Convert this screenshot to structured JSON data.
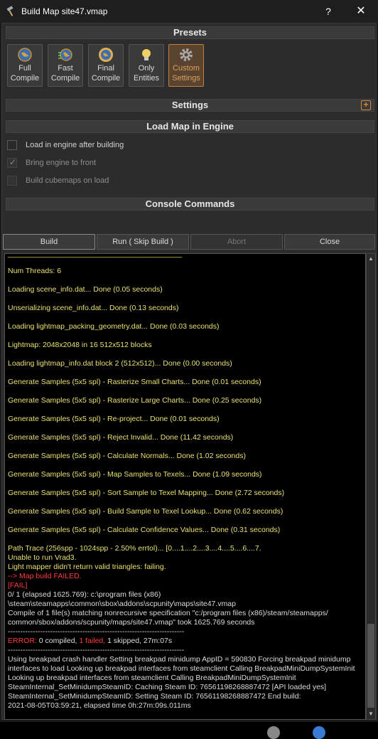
{
  "window": {
    "title": "Build Map site47.vmap",
    "help_glyph": "?",
    "close_glyph": "✕"
  },
  "presets": {
    "header": "Presets",
    "items": [
      {
        "line1": "Full",
        "line2": "Compile",
        "icon": "globe-icon"
      },
      {
        "line1": "Fast",
        "line2": "Compile",
        "icon": "globe-fast-icon"
      },
      {
        "line1": "Final",
        "line2": "Compile",
        "icon": "globe-final-icon"
      },
      {
        "line1": "Only",
        "line2": "Entities",
        "icon": "lightbulb-icon"
      },
      {
        "line1": "Custom",
        "line2": "Settings",
        "icon": "gear-icon"
      }
    ]
  },
  "settings": {
    "header": "Settings",
    "expand_glyph": "+"
  },
  "load_map": {
    "header": "Load Map in Engine",
    "options": [
      {
        "label": "Load in engine after building",
        "checked": false,
        "enabled": true
      },
      {
        "label": "Bring engine to front",
        "checked": true,
        "enabled": false
      },
      {
        "label": "Build cubemaps on load",
        "checked": false,
        "enabled": false
      }
    ]
  },
  "console_commands": {
    "header": "Console Commands"
  },
  "actions": {
    "build": "Build",
    "run": "Run ( Skip Build )",
    "abort": "Abort",
    "close": "Close"
  },
  "console": {
    "lines": [
      {
        "text": "Num Threads: 6",
        "color": "y"
      },
      {
        "text": "Loading scene_info.dat... Done (0.05 seconds)",
        "color": "y"
      },
      {
        "text": "Unserializing scene_info.dat... Done (0.13 seconds)",
        "color": "y"
      },
      {
        "text": "Loading lightmap_packing_geometry.dat... Done (0.03 seconds)",
        "color": "y"
      },
      {
        "text": "Lightmap: 2048x2048 in 16 512x512 blocks",
        "color": "y"
      },
      {
        "text": "Loading lightmap_info.dat block 2 (512x512)... Done (0.00 seconds)",
        "color": "y"
      },
      {
        "text": "Generate Samples (5x5 spl) - Rasterize Small Charts... Done (0.01 seconds)",
        "color": "y"
      },
      {
        "text": "Generate Samples (5x5 spl) - Rasterize Large Charts... Done (0.25 seconds)",
        "color": "y"
      },
      {
        "text": "Generate Samples (5x5 spl) - Re-project... Done (0.01 seconds)",
        "color": "y"
      },
      {
        "text": "Generate Samples (5x5 spl) - Reject Invalid... Done (11.42 seconds)",
        "color": "y"
      },
      {
        "text": "Generate Samples (5x5 spl) - Calculate Normals... Done (1.02 seconds)",
        "color": "y"
      },
      {
        "text": "Generate Samples (5x5 spl) - Map Samples to Texels... Done (1.09 seconds)",
        "color": "y"
      },
      {
        "text": "Generate Samples (5x5 spl) - Sort Sample to Texel Mapping... Done (2.72 seconds)",
        "color": "y"
      },
      {
        "text": "Generate Samples (5x5 spl) - Build Sample to Texel Lookup... Done (0.62 seconds)",
        "color": "y"
      },
      {
        "text": "Generate Samples (5x5 spl) - Calculate Confidence Values... Done (0.31 seconds)",
        "color": "y"
      }
    ],
    "tail": [
      {
        "text": "Path Trace (256spp - 1024spp - 2.50% errtol)... [0....1....2....3....4....5....6....7.",
        "color": "y"
      },
      {
        "text": "Unable to run Vrad3.",
        "color": "y"
      },
      {
        "text": "Light mapper didn't return valid triangles: failing.",
        "color": "y"
      },
      {
        "text": "--> Map build FAILED.",
        "color": "r"
      },
      {
        "text": "[FAIL]",
        "color": "r"
      },
      {
        "text": "0/ 1 (elapsed 1625.769): c:\\program files (x86)",
        "color": "w"
      },
      {
        "text": "\\steam\\steamapps\\common\\sbox\\addons\\scpunity\\maps\\site47.vmap",
        "color": "w"
      },
      {
        "text": "Compile of 1 file(s) matching nonrecursive specification \"c:/program files (x86)/steam/steamapps/",
        "color": "w"
      },
      {
        "text": "common/sbox/addons/scpunity/maps/site47.vmap\" took 1625.769 seconds",
        "color": "w"
      },
      {
        "text": "-----------------------------------------------------------------------",
        "color": "w"
      }
    ],
    "error_summary": {
      "prefix": "ERROR:",
      "compiled": "0 compiled,",
      "failed": "1 failed,",
      "rest": "1 skipped, 27m:07s"
    },
    "footer": [
      {
        "text": "-----------------------------------------------------------------------",
        "color": "w"
      },
      {
        "text": "Using breakpad crash handler Setting breakpad minidump AppID = 590830 Forcing breakpad minidump",
        "color": "w"
      },
      {
        "text": "interfaces to load Looking up breakpad interfaces from steamclient Calling BreakpadMiniDumpSystemInit",
        "color": "w"
      },
      {
        "text": "Looking up breakpad interfaces from steamclient Calling BreakpadMiniDumpSystemInit",
        "color": "w"
      },
      {
        "text": "SteamInternal_SetMinidumpSteamID: Caching Steam ID: 76561198268887472 [API loaded yes]",
        "color": "w"
      },
      {
        "text": "SteamInternal_SetMinidumpSteamID: Setting Steam ID: 76561198268887472 End build:",
        "color": "w"
      },
      {
        "text": "2021-08-05T03:59:21, elapsed time 0h:27m:09s.011ms",
        "color": "w"
      }
    ]
  },
  "colors": {
    "accent": "#d08a3a",
    "console_yellow": "#e8e070",
    "console_red": "#ff3c3c"
  }
}
